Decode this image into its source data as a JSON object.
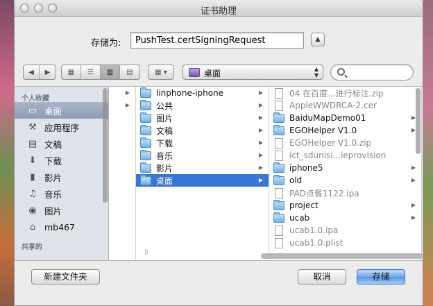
{
  "window": {
    "title": "证书助理"
  },
  "save": {
    "label": "存储为:",
    "filename": "PushTest.certSigningRequest"
  },
  "toolbar": {
    "location": "桌面",
    "search_placeholder": ""
  },
  "sidebar": {
    "sections": [
      {
        "header": "个人收藏",
        "items": [
          {
            "label": "桌面",
            "icon": "desktop-icon",
            "selected": true
          },
          {
            "label": "应用程序",
            "icon": "applications-icon"
          },
          {
            "label": "文稿",
            "icon": "documents-icon"
          },
          {
            "label": "下载",
            "icon": "downloads-icon"
          },
          {
            "label": "影片",
            "icon": "movies-icon"
          },
          {
            "label": "音乐",
            "icon": "music-icon"
          },
          {
            "label": "图片",
            "icon": "pictures-icon"
          },
          {
            "label": "mb467",
            "icon": "home-icon"
          }
        ]
      },
      {
        "header": "共享的",
        "items": []
      }
    ]
  },
  "columns": {
    "col1": [
      {
        "name": "linphone-iphone",
        "type": "folder",
        "has_children": true
      },
      {
        "name": "公共",
        "type": "folder",
        "has_children": true
      },
      {
        "name": "图片",
        "type": "folder",
        "has_children": true
      },
      {
        "name": "文稿",
        "type": "folder",
        "has_children": true
      },
      {
        "name": "下载",
        "type": "folder",
        "has_children": true
      },
      {
        "name": "音乐",
        "type": "folder",
        "has_children": true
      },
      {
        "name": "影片",
        "type": "folder",
        "has_children": true
      },
      {
        "name": "桌面",
        "type": "folder",
        "has_children": true,
        "selected": true
      }
    ],
    "col2": [
      {
        "name": "04 在百度...进行标注.zip",
        "type": "file",
        "dim": true
      },
      {
        "name": "AppleWWDRCA-2.cer",
        "type": "file",
        "dim": true
      },
      {
        "name": "BaiduMapDemo01",
        "type": "folder",
        "has_children": true
      },
      {
        "name": "EGOHelper V1.0",
        "type": "folder",
        "has_children": true
      },
      {
        "name": "EGOHelper V1.0.zip",
        "type": "file",
        "dim": true
      },
      {
        "name": "ict_sdunisi...leprovision",
        "type": "file",
        "dim": true
      },
      {
        "name": "iphone5",
        "type": "folder",
        "has_children": true
      },
      {
        "name": "old",
        "type": "folder",
        "has_children": true
      },
      {
        "name": "PAD点餐1122.ipa",
        "type": "file",
        "dim": true
      },
      {
        "name": "project",
        "type": "folder",
        "has_children": true
      },
      {
        "name": "ucab",
        "type": "folder",
        "has_children": true
      },
      {
        "name": "ucab1.0.ipa",
        "type": "file",
        "dim": true
      },
      {
        "name": "ucab1.0.plist",
        "type": "file",
        "dim": true
      }
    ]
  },
  "buttons": {
    "new_folder": "新建文件夹",
    "cancel": "取消",
    "save": "存储"
  }
}
